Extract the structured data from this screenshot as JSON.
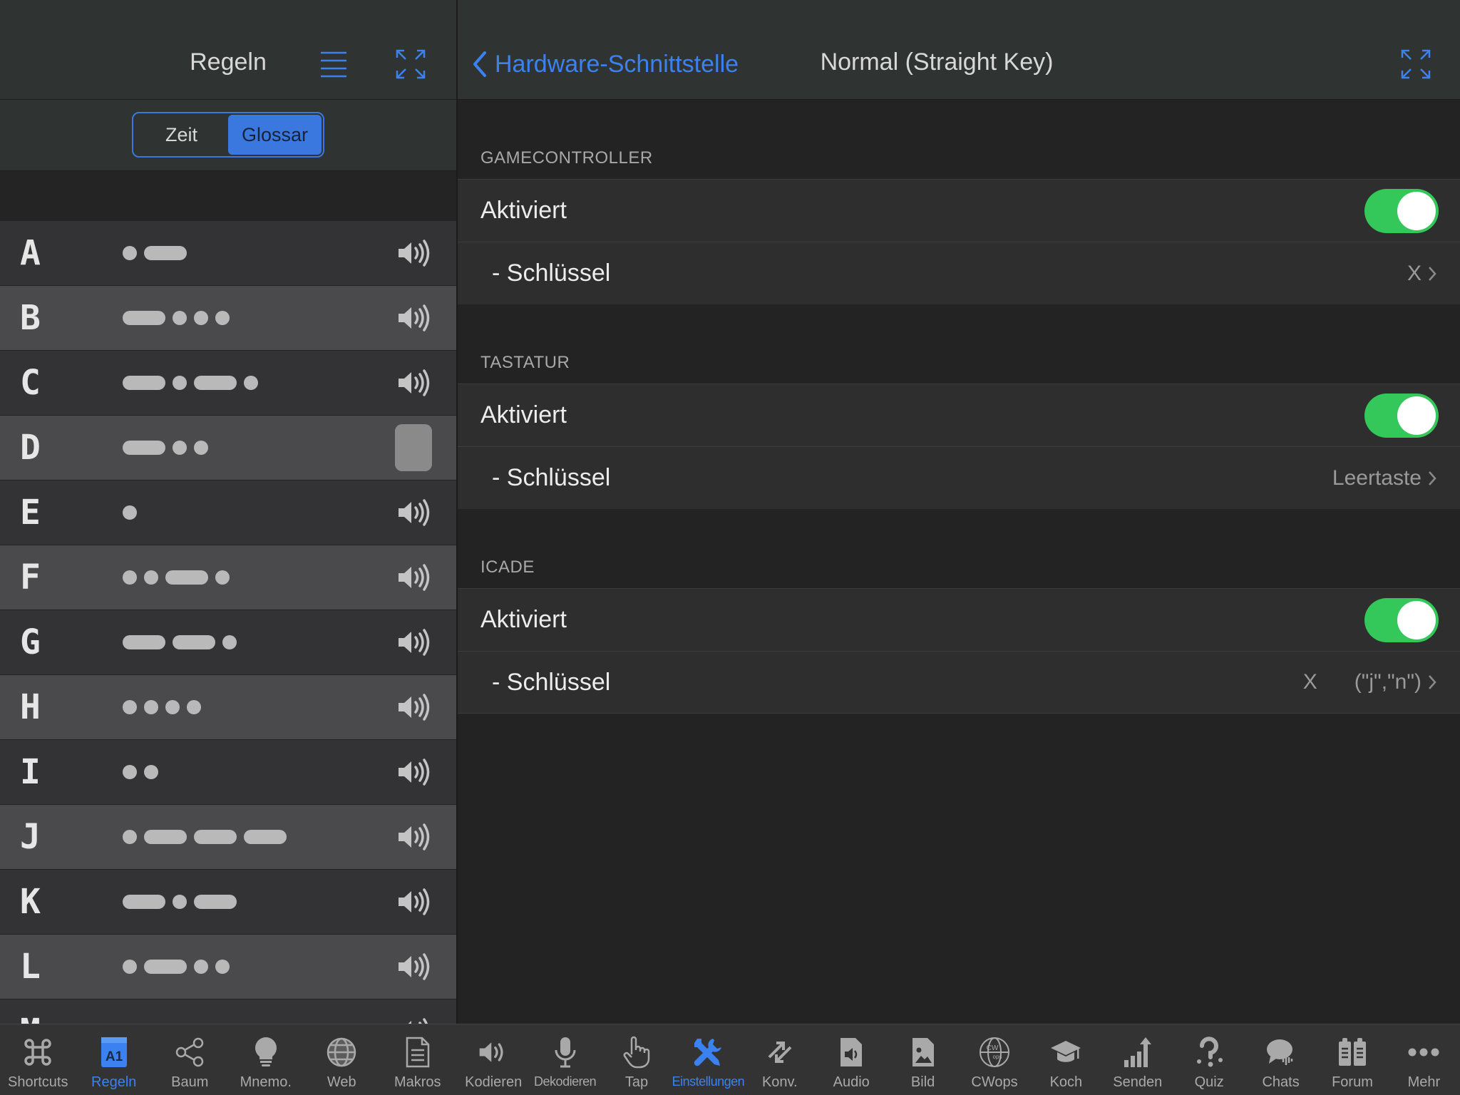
{
  "left_pane": {
    "title": "Regeln",
    "segmented": {
      "options": [
        "Zeit",
        "Glossar"
      ],
      "selected": "Glossar"
    },
    "rows": [
      {
        "letter": "A",
        "code": ".-"
      },
      {
        "letter": "B",
        "code": "-..."
      },
      {
        "letter": "C",
        "code": "-.-."
      },
      {
        "letter": "D",
        "code": "-.."
      },
      {
        "letter": "E",
        "code": "."
      },
      {
        "letter": "F",
        "code": "..-."
      },
      {
        "letter": "G",
        "code": "--."
      },
      {
        "letter": "H",
        "code": "...."
      },
      {
        "letter": "I",
        "code": ".."
      },
      {
        "letter": "J",
        "code": ".---"
      },
      {
        "letter": "K",
        "code": "-.-"
      },
      {
        "letter": "L",
        "code": ".-.."
      },
      {
        "letter": "M",
        "code": "--"
      }
    ]
  },
  "right_pane": {
    "back_label": "Hardware-Schnittstelle",
    "title": "Normal (Straight Key)",
    "sections": [
      {
        "title": "GAMECONTROLLER",
        "toggle_label": "Aktiviert",
        "toggle_on": true,
        "key_label": "- Schlüssel",
        "key_value": "X",
        "key_extra": ""
      },
      {
        "title": "TASTATUR",
        "toggle_label": "Aktiviert",
        "toggle_on": true,
        "key_label": "- Schlüssel",
        "key_value": "Leertaste",
        "key_extra": ""
      },
      {
        "title": "ICADE",
        "toggle_label": "Aktiviert",
        "toggle_on": true,
        "key_label": "- Schlüssel",
        "key_value": "(\"j\",\"n\")",
        "key_extra": "X"
      }
    ]
  },
  "tabbar": {
    "left_tabs": [
      {
        "label": "Shortcuts",
        "icon": "command-icon"
      },
      {
        "label": "Regeln",
        "icon": "rules-icon",
        "active": true
      },
      {
        "label": "Baum",
        "icon": "tree-icon"
      },
      {
        "label": "Mnemo.",
        "icon": "lightbulb-icon"
      },
      {
        "label": "Web",
        "icon": "globe-icon"
      },
      {
        "label": "Makros",
        "icon": "document-icon"
      }
    ],
    "right_tabs": [
      {
        "label": "Kodieren",
        "icon": "speaker-icon"
      },
      {
        "label": "Dekodieren",
        "icon": "microphone-icon"
      },
      {
        "label": "Tap",
        "icon": "hand-icon"
      },
      {
        "label": "Einstellungen",
        "icon": "tools-icon",
        "active": true
      },
      {
        "label": "Konv.",
        "icon": "convert-icon"
      },
      {
        "label": "Audio",
        "icon": "audio-file-icon"
      },
      {
        "label": "Bild",
        "icon": "image-file-icon"
      },
      {
        "label": "CWops",
        "icon": "cwops-icon"
      },
      {
        "label": "Koch",
        "icon": "graduation-cap-icon"
      },
      {
        "label": "Senden",
        "icon": "chart-up-icon"
      },
      {
        "label": "Quiz",
        "icon": "question-icon"
      },
      {
        "label": "Chats",
        "icon": "chat-icon"
      },
      {
        "label": "Forum",
        "icon": "forum-icon"
      },
      {
        "label": "Mehr",
        "icon": "more-icon"
      }
    ]
  },
  "colors": {
    "accent": "#3b82f0",
    "toggle_on": "#34c759",
    "row_light": "#4a4a4c",
    "row_dark": "#333335"
  }
}
